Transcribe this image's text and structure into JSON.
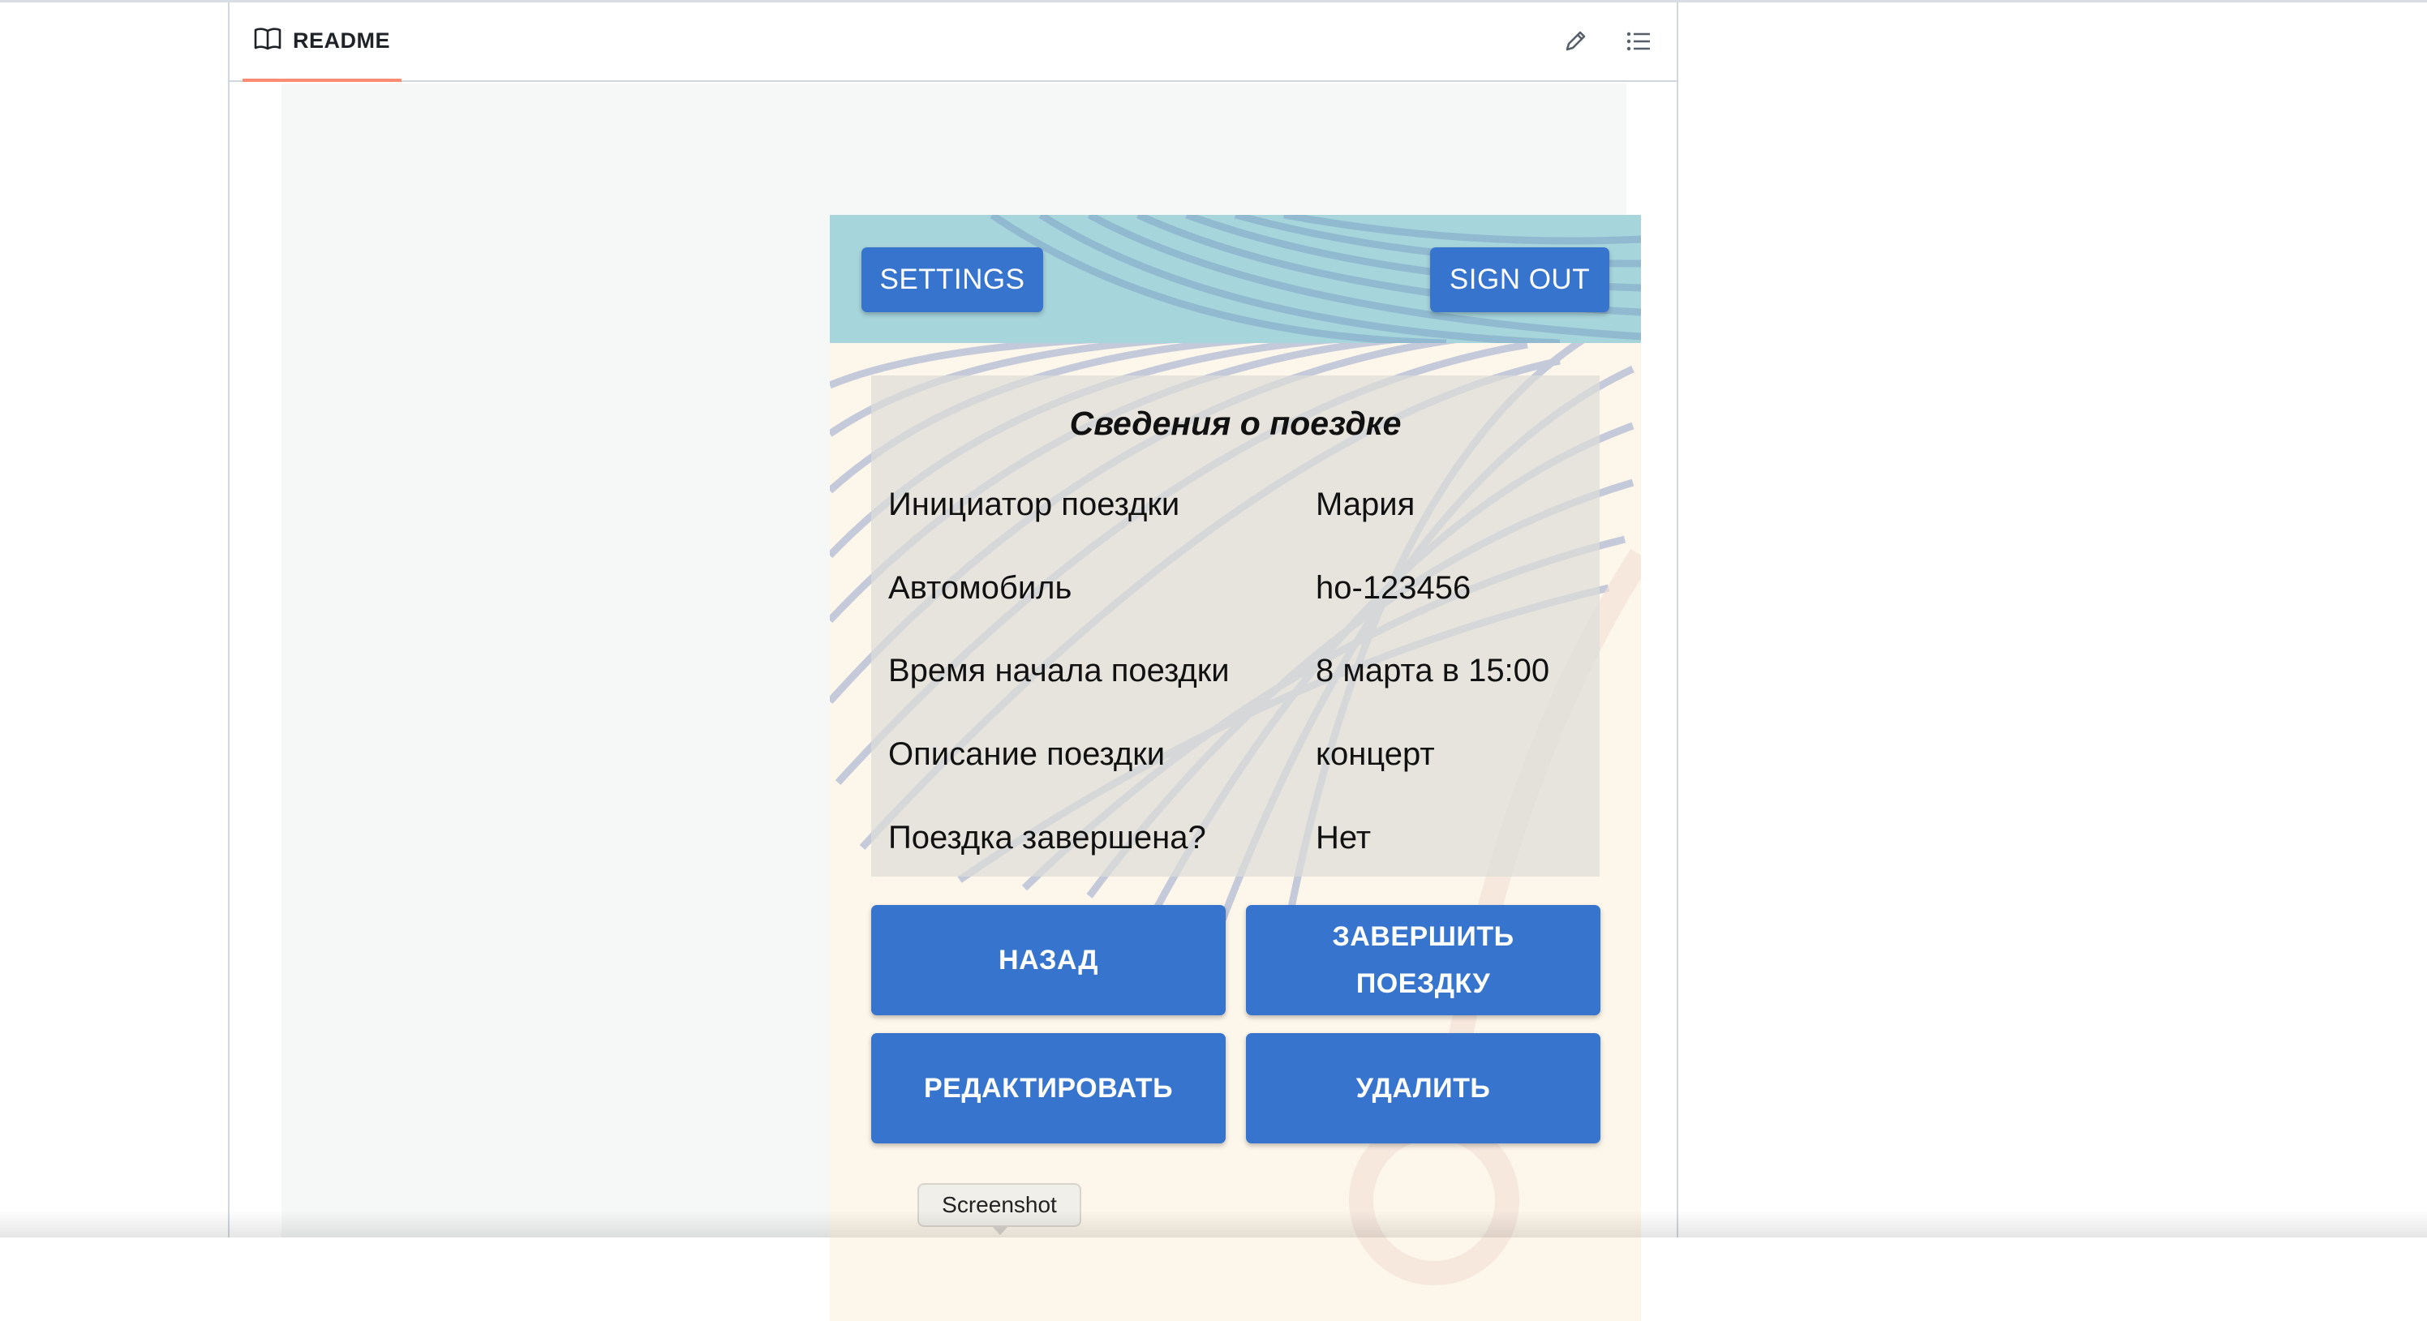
{
  "readme": {
    "tab_label": "README",
    "tab_icon": "book-icon",
    "edit_icon": "pencil-icon",
    "outline_icon": "list-icon"
  },
  "app": {
    "settings_label": "SETTINGS",
    "signout_label": "SIGN OUT",
    "accent_color": "#3674ce",
    "card": {
      "title": "Сведения о поездке",
      "rows": [
        {
          "label": "Инициатор поездки",
          "value": "Мария"
        },
        {
          "label": "Автомобиль",
          "value": "ho-123456"
        },
        {
          "label": "Время начала поездки",
          "value": "8 марта в 15:00"
        },
        {
          "label": "Описание поездки",
          "value": "концерт"
        },
        {
          "label": "Поездка завершена?",
          "value": "Нет"
        }
      ]
    },
    "actions": {
      "back": "НАЗАД",
      "finish_line1": "ЗАВЕРШИТЬ",
      "finish_line2": "ПОЕЗДКУ",
      "edit": "РЕДАКТИРОВАТЬ",
      "delete": "УДАЛИТЬ"
    }
  },
  "tooltip": {
    "text": "Screenshot"
  }
}
